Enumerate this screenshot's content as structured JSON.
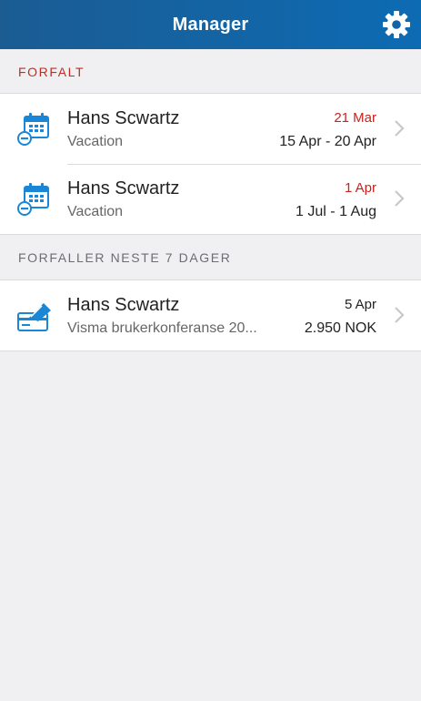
{
  "app": {
    "title": "Manager",
    "accent_color": "#0d6bb3",
    "overdue_color": "#d0201a"
  },
  "nav": {
    "settings_icon": "gear-icon"
  },
  "sections": [
    {
      "header": "FORFALT",
      "header_color": "#c62a1f",
      "items": [
        {
          "icon": "calendar-minus-icon",
          "name": "Hans Scwartz",
          "subtitle": "Vacation",
          "date": "21 Mar",
          "date_overdue": true,
          "range": "15 Apr - 20 Apr"
        },
        {
          "icon": "calendar-minus-icon",
          "name": "Hans Scwartz",
          "subtitle": "Vacation",
          "date": "1 Apr",
          "date_overdue": true,
          "range": "1 Jul - 1 Aug"
        }
      ]
    },
    {
      "header": "FORFALLER NESTE 7 DAGER",
      "header_color": "#6d6d72",
      "items": [
        {
          "icon": "expense-card-icon",
          "name": "Hans Scwartz",
          "subtitle": "Visma brukerkonferanse 20...",
          "date": "5 Apr",
          "date_overdue": false,
          "range": "2.950 NOK"
        }
      ]
    }
  ]
}
